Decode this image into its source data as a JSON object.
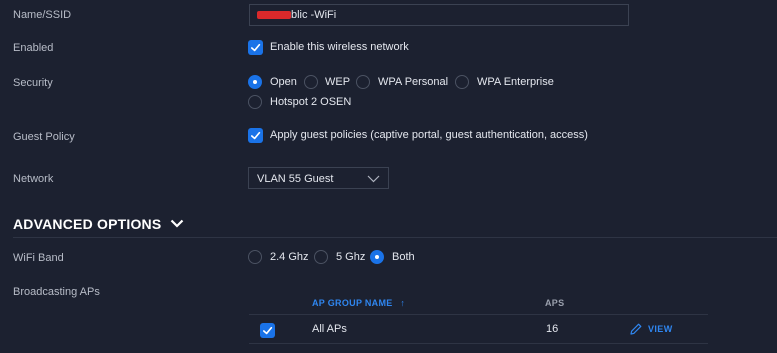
{
  "form": {
    "name_label": "Name/SSID",
    "name_value_visible": "blic -WiFi",
    "enabled_label": "Enabled",
    "enabled_checkbox_text": "Enable this wireless network",
    "security_label": "Security",
    "security_options": [
      "Open",
      "WEP",
      "WPA Personal",
      "WPA Enterprise",
      "Hotspot 2 OSEN"
    ],
    "security_selected": "Open",
    "guest_policy_label": "Guest Policy",
    "guest_policy_text": "Apply guest policies (captive portal, guest authentication, access)",
    "network_label": "Network",
    "network_value": "VLAN 55 Guest"
  },
  "advanced": {
    "title": "ADVANCED OPTIONS",
    "wifi_band_label": "WiFi Band",
    "wifi_band_options": [
      "2.4 Ghz",
      "5 Ghz",
      "Both"
    ],
    "wifi_band_selected": "Both",
    "broadcasting_label": "Broadcasting APs"
  },
  "ap_table": {
    "headers": [
      "AP GROUP NAME",
      "APS"
    ],
    "sort_indicator": "↑",
    "rows": [
      {
        "name": "All APs",
        "aps": "16",
        "action": "VIEW",
        "checked": true
      }
    ]
  },
  "colors": {
    "background": "#1c2130",
    "accent": "#1a73e8",
    "link": "#2f86f0",
    "redaction": "#d9292b"
  },
  "icons": [
    "check-icon",
    "chevron-down-icon",
    "sort-up-icon",
    "pencil-icon"
  ]
}
